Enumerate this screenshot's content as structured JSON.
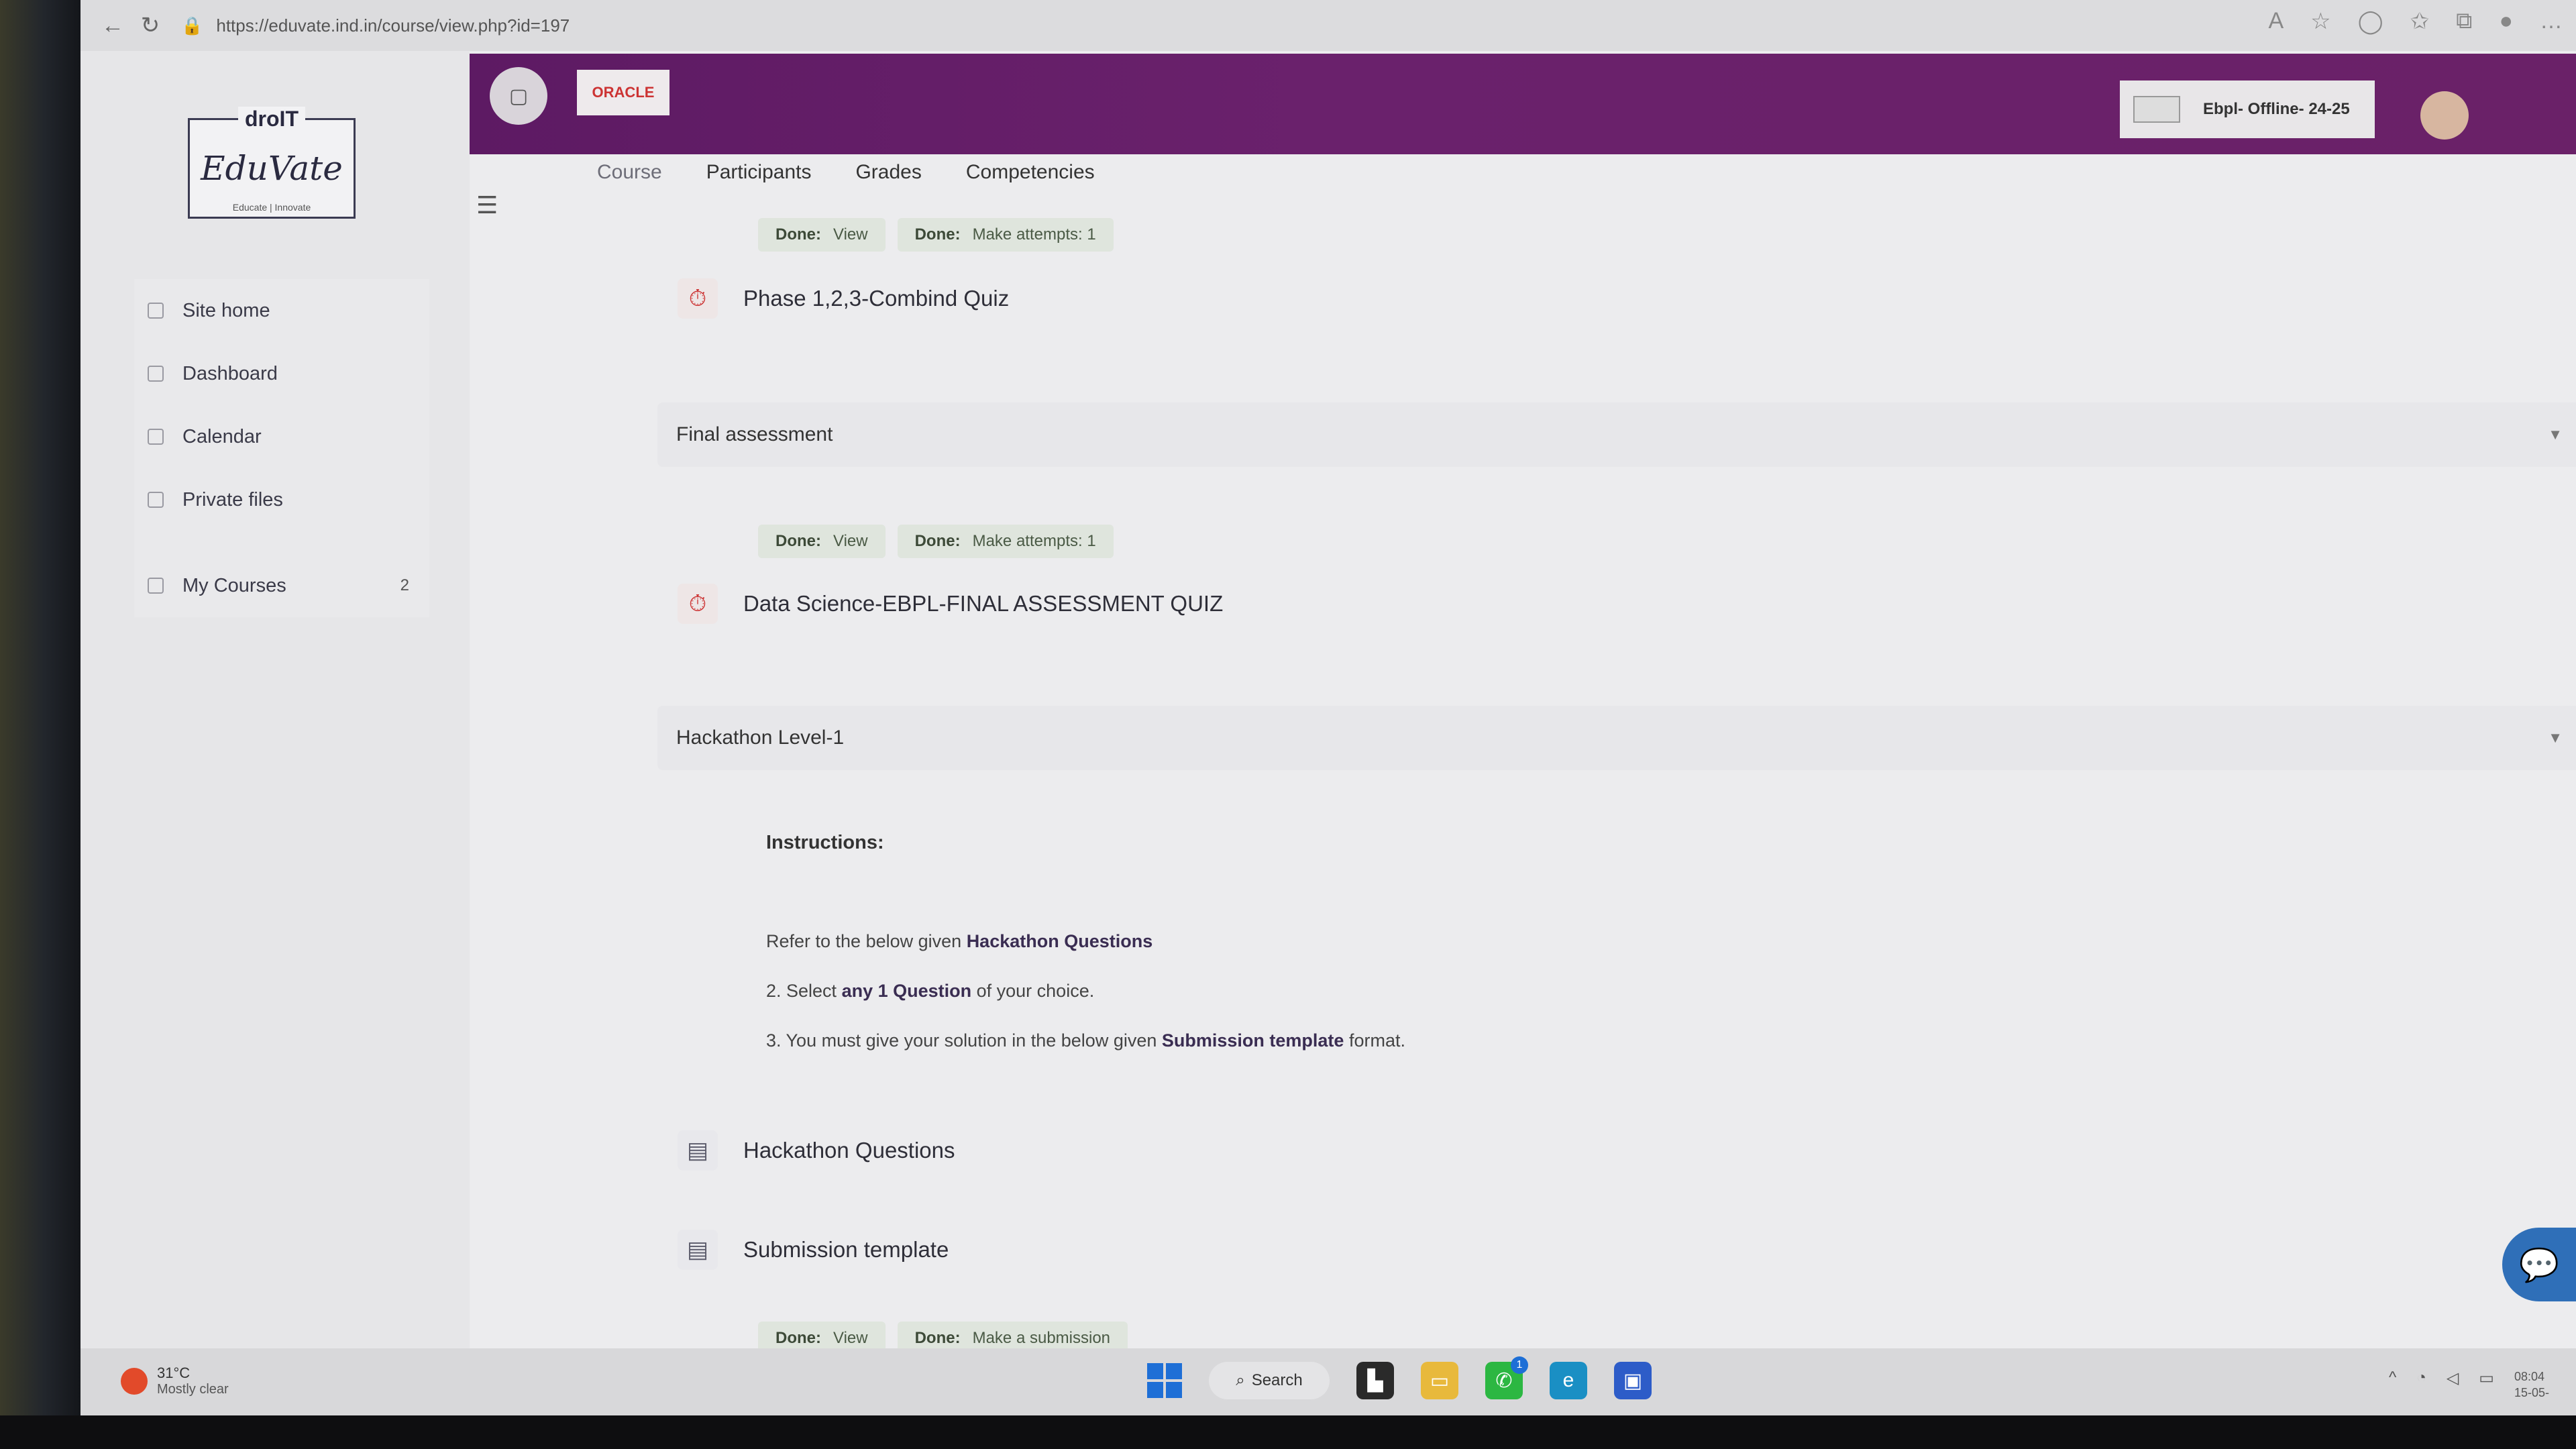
{
  "browser": {
    "url": "https://eduvate.ind.in/course/view.php?id=197"
  },
  "logo": {
    "top": "droIT",
    "main": "EduVate",
    "tagline": "Educate | Innovate"
  },
  "sidebar": {
    "items": [
      {
        "label": "Site home",
        "icon": "home-icon"
      },
      {
        "label": "Dashboard",
        "icon": "dashboard-icon"
      },
      {
        "label": "Calendar",
        "icon": "calendar-icon"
      },
      {
        "label": "Private files",
        "icon": "file-icon"
      }
    ],
    "my_courses": {
      "label": "My Courses",
      "count": "2"
    }
  },
  "header": {
    "oracle_label": "ORACLE",
    "course_name": "Ebpl- Offline- 24-25",
    "brand_color": "#6a216c"
  },
  "tabs": [
    "Course",
    "Participants",
    "Grades",
    "Competencies"
  ],
  "blocks": {
    "quiz1": {
      "badge1": {
        "status": "Done:",
        "text": "View"
      },
      "badge2": {
        "status": "Done:",
        "text": "Make attempts: 1"
      },
      "title": "Phase 1,2,3-Combind Quiz",
      "icon": "quiz-icon"
    },
    "section_final": {
      "title": "Final assessment"
    },
    "quiz2": {
      "badge1": {
        "status": "Done:",
        "text": "View"
      },
      "badge2": {
        "status": "Done:",
        "text": "Make attempts: 1"
      },
      "title": "Data Science-EBPL-FINAL ASSESSMENT QUIZ",
      "icon": "quiz-icon"
    },
    "section_hackathon": {
      "title": "Hackathon Level-1"
    },
    "instructions": {
      "title": "Instructions:",
      "line1_pre": "Refer to the below given ",
      "line1_bold": "Hackathon Questions",
      "line2_pre": "2. Select ",
      "line2_bold": "any 1 Question",
      "line2_post": " of your choice.",
      "line3_pre": "3. You must give your solution in the below given ",
      "line3_bold": "Submission template",
      "line3_post": " format."
    },
    "resource1": {
      "title": "Hackathon Questions",
      "icon": "folder-icon"
    },
    "resource2": {
      "title": "Submission template",
      "icon": "folder-icon"
    },
    "assign": {
      "badge1": {
        "status": "Done:",
        "text": "View"
      },
      "badge2": {
        "status": "Done:",
        "text": "Make a submission"
      }
    }
  },
  "taskbar": {
    "temperature": "31°C",
    "condition": "Mostly clear",
    "search_label": "Search",
    "whatsapp_badge": "1",
    "time": "08:04",
    "date": "15-05-"
  }
}
